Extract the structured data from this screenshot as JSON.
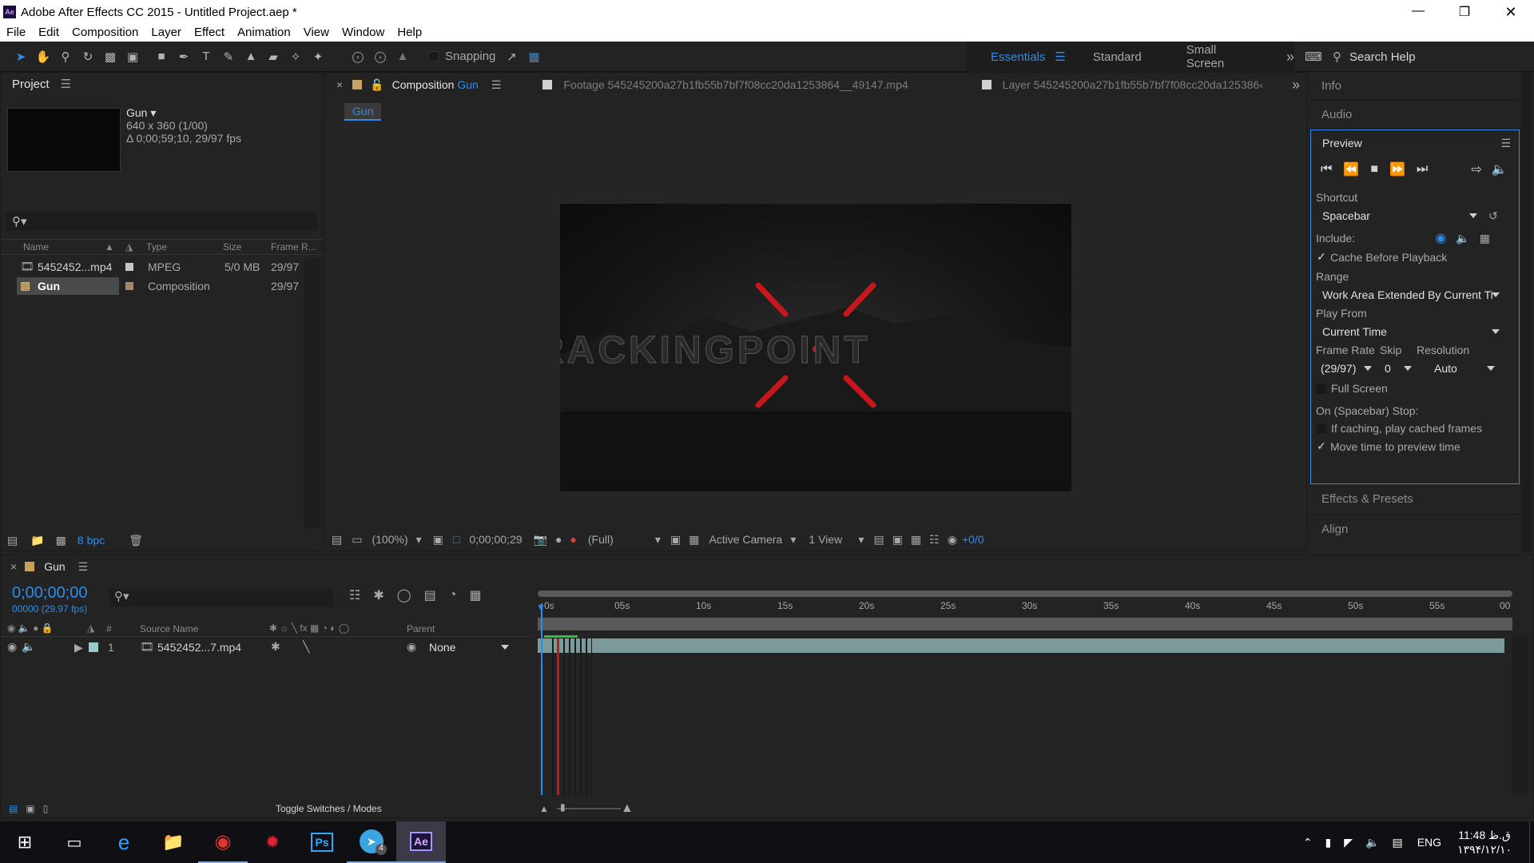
{
  "window": {
    "app_icon": "Ae",
    "title": "Adobe After Effects CC 2015 - Untitled Project.aep *"
  },
  "menu": [
    "File",
    "Edit",
    "Composition",
    "Layer",
    "Effect",
    "Animation",
    "View",
    "Window",
    "Help"
  ],
  "toolbar": {
    "snapping": "Snapping",
    "workspaces": [
      "Essentials",
      "Standard",
      "Small Screen"
    ],
    "search_help": "Search Help"
  },
  "project": {
    "tab": "Project",
    "selected_name": "Gun ▾",
    "selected_dims": "640 x 360 (1/00)",
    "selected_duration": "Δ 0;00;59;10, 29/97 fps",
    "columns": [
      "Name",
      "Type",
      "Size",
      "Frame R..."
    ],
    "rows": [
      {
        "name": "5452452...mp4",
        "type": "MPEG",
        "size": "5/0 MB",
        "fps": "29/97"
      },
      {
        "name": "Gun",
        "type": "Composition",
        "size": "",
        "fps": "29/97"
      }
    ],
    "bpc": "8 bpc"
  },
  "viewer": {
    "tabs": [
      {
        "label": "Composition",
        "name": "Gun"
      },
      {
        "label": "Footage",
        "name": "545245200a27b1fb55b7bf7f08cc20da1253864__49147.mp4"
      },
      {
        "label": "Layer",
        "name": "545245200a27b1fb55b7bf7f08cc20da125386‹"
      }
    ],
    "comp_name_chip": "Gun",
    "frame_text": "RACKINGPOINT",
    "zoom": "(100%)",
    "timecode": "0;00;00;29",
    "resolution": "(Full)",
    "camera": "Active Camera",
    "views": "1 View",
    "exposure": "+0/0"
  },
  "right_panels": {
    "info": "Info",
    "audio": "Audio",
    "preview": {
      "title": "Preview",
      "shortcut_label": "Shortcut",
      "shortcut_value": "Spacebar",
      "include_label": "Include:",
      "cache_before": "Cache Before Playback",
      "range_label": "Range",
      "range_value": "Work Area Extended By Current Ti",
      "play_from_label": "Play From",
      "play_from_value": "Current Time",
      "frame_rate_label": "Frame Rate",
      "skip_label": "Skip",
      "resolution_label": "Resolution",
      "frame_rate_value": "(29/97)",
      "skip_value": "0",
      "resolution_value": "Auto",
      "full_screen": "Full Screen",
      "on_stop": "On (Spacebar) Stop:",
      "if_caching": "If caching, play cached frames",
      "move_time": "Move time to preview time"
    },
    "effects": "Effects & Presets",
    "align": "Align"
  },
  "timeline": {
    "tab": "Gun",
    "timecode": "0;00;00;00",
    "frame_count": "00000 (29.97 fps)",
    "columns": {
      "num": "#",
      "source": "Source Name",
      "parent": "Parent"
    },
    "ruler": [
      "0s",
      "05s",
      "10s",
      "15s",
      "20s",
      "25s",
      "30s",
      "35s",
      "40s",
      "45s",
      "50s",
      "55s",
      "00"
    ],
    "layers": [
      {
        "num": "1",
        "name": "5452452...7.mp4",
        "parent": "None"
      }
    ],
    "toggle": "Toggle Switches / Modes"
  },
  "taskbar": {
    "lang": "ENG",
    "time": "11:48 ق.ظ",
    "date": "۱۳۹۴/۱۲/۱۰",
    "telegram_badge": "4"
  },
  "colors": {
    "accent": "#2d8ceb",
    "panel_bg": "#232323",
    "playhead": "#2d8ceb",
    "layer_bar": "#7d9a9a"
  }
}
